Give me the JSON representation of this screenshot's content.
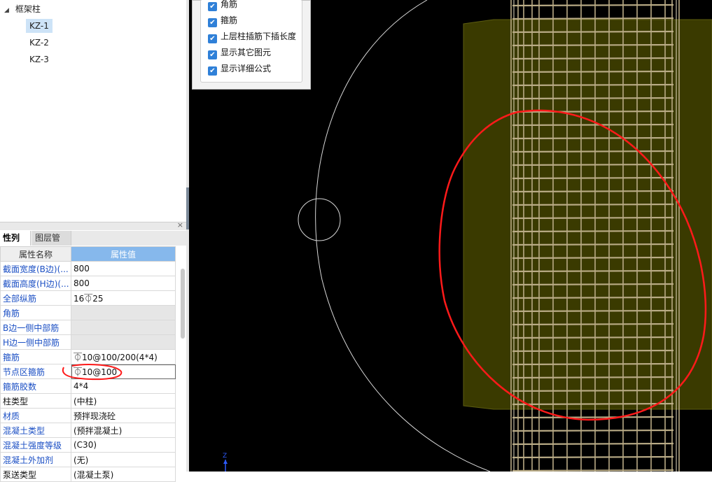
{
  "tree": {
    "root_label": "框架柱",
    "items": [
      "KZ-1",
      "KZ-2",
      "KZ-3"
    ],
    "selected": "KZ-1"
  },
  "props_panel": {
    "tabs": [
      "性列表",
      "图层管理"
    ],
    "close_glyph": "×",
    "columns": [
      "属性名称",
      "属性值"
    ],
    "rows": [
      {
        "name": "截面宽度(B边)(...",
        "value": "800"
      },
      {
        "name": "截面高度(H边)(...",
        "value": "800"
      },
      {
        "name": "全部纵筋",
        "value": "16⏁25"
      },
      {
        "name": "角筋",
        "value": ""
      },
      {
        "name": "B边一侧中部筋",
        "value": ""
      },
      {
        "name": "H边一侧中部筋",
        "value": ""
      },
      {
        "name": "箍筋",
        "value": "⏁10@100/200(4*4)"
      },
      {
        "name": "节点区箍筋",
        "value": "⏁10@100"
      },
      {
        "name": "箍筋胶数",
        "value": "4*4"
      },
      {
        "name": "柱类型",
        "value": "(中柱)"
      },
      {
        "name": "材质",
        "value": "预拌现浇砼"
      },
      {
        "name": "混凝土类型",
        "value": "(预拌混凝土)"
      },
      {
        "name": "混凝土强度等级",
        "value": "(C30)"
      },
      {
        "name": "混凝土外加剂",
        "value": "(无)"
      },
      {
        "name": "泵送类型",
        "value": "(混凝土泵)"
      }
    ]
  },
  "display_options": {
    "items": [
      "角筋",
      "箍筋",
      "上层柱插筋下插长度",
      "显示其它图元",
      "显示详细公式"
    ],
    "checked": [
      true,
      true,
      true,
      true,
      true
    ]
  },
  "viewport": {
    "axis_label": "Z",
    "annotation_color": "#ff1a1a",
    "column_color": "#3a3a00",
    "rebar_color": "#b9ab86"
  }
}
